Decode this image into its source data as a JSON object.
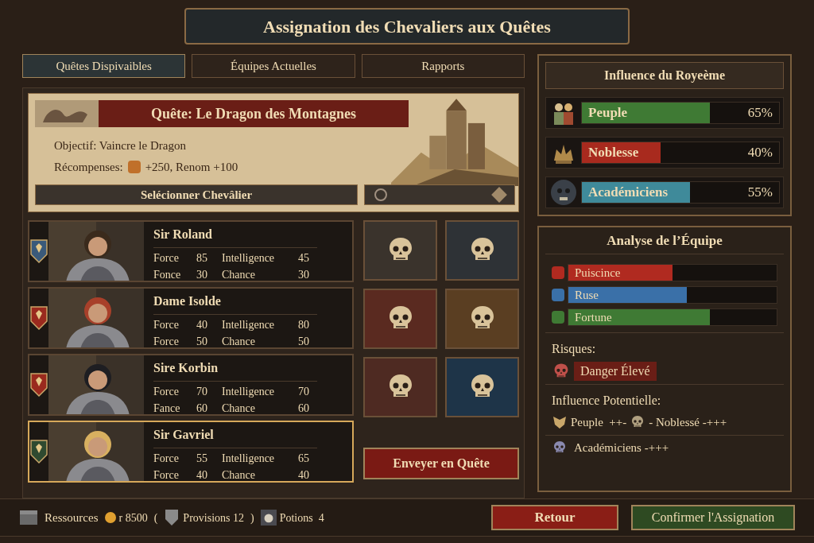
{
  "title": "Assignation des Chevaliers aux Quêtes",
  "tabs": [
    {
      "label": "Quêtes Dispivaibles",
      "selected": true
    },
    {
      "label": "Équipes Actuelles",
      "selected": false
    },
    {
      "label": "Rapports",
      "selected": false
    }
  ],
  "quest": {
    "title": "Quête: Le Dragon des Montagnes",
    "objective": "Objectif: Vaincre le Dragon",
    "rewards_label": "Récompenses:",
    "rewards_value": "+250, Renom +100",
    "select_button": "Selécionner Chevâlier"
  },
  "knights": [
    {
      "name": "Sir Roland",
      "selected": false,
      "color": "#3a5a7a",
      "stats": [
        {
          "label": "Force",
          "value": "85"
        },
        {
          "label": "Intelligence",
          "value": "45"
        },
        {
          "label": "Fonce",
          "value": "30"
        },
        {
          "label": "Chance",
          "value": "30"
        }
      ]
    },
    {
      "name": "Dame Isolde",
      "selected": false,
      "color": "#9a2a1e",
      "stats": [
        {
          "label": "Force",
          "value": "40"
        },
        {
          "label": "Intelligence",
          "value": "80"
        },
        {
          "label": "Force",
          "value": "50"
        },
        {
          "label": "Chance",
          "value": "50"
        }
      ]
    },
    {
      "name": "Sire Korbin",
      "selected": false,
      "color": "#9a2a1e",
      "stats": [
        {
          "label": "Force",
          "value": "70"
        },
        {
          "label": "Intelligence",
          "value": "70"
        },
        {
          "label": "Fance",
          "value": "60"
        },
        {
          "label": "Chance",
          "value": "60"
        }
      ]
    },
    {
      "name": "Sir Gavriel",
      "selected": true,
      "color": "#2f4a30",
      "stats": [
        {
          "label": "Force",
          "value": "55"
        },
        {
          "label": "Intelligence",
          "value": "65"
        },
        {
          "label": "Force",
          "value": "40"
        },
        {
          "label": "Chance",
          "value": "40"
        }
      ]
    }
  ],
  "equipment": [
    {
      "color": "#3a332c"
    },
    {
      "color": "#2e3236"
    },
    {
      "color": "#5a2a20"
    },
    {
      "color": "#5a3e22"
    },
    {
      "color": "#4e2a22"
    },
    {
      "color": "#1e3448"
    }
  ],
  "send_button": "Enveyer en Quête",
  "influence": {
    "title": "Influence du Royeème",
    "factions": [
      {
        "name": "Peuple",
        "level": 0.65,
        "reading": "65%",
        "color": "#3f7a34"
      },
      {
        "name": "Noblesse",
        "level": 0.4,
        "reading": "40%",
        "color": "#a82a1e"
      },
      {
        "name": "Académiciens",
        "level": 0.55,
        "reading": "55%",
        "color": "#3f8a9a"
      }
    ]
  },
  "analysis": {
    "title": "Analyse de l’Équipe",
    "attributes": [
      {
        "name": "Puiscince",
        "level": 0.5,
        "color": "#b02a20"
      },
      {
        "name": "Ruse",
        "level": 0.57,
        "color": "#3a70a8"
      },
      {
        "name": "Fortune",
        "level": 0.68,
        "color": "#3f7a34"
      }
    ],
    "risks_label": "Risques:",
    "risk": "Danger Élevé",
    "potential_label": "Influence Potentielle:",
    "potential_line_1a": "Peuple  ++-",
    "potential_line_1b": "- Noblessé -+++",
    "potential_line_2": "Académiciens -+++"
  },
  "resources": {
    "label": "Ressources",
    "items": [
      {
        "kind": "coin",
        "text": "r 8500"
      },
      {
        "kind": "plain",
        "text": "("
      },
      {
        "kind": "shield",
        "text": "Provisions 12"
      },
      {
        "kind": "plain",
        "text": ")"
      },
      {
        "kind": "potion",
        "text": "Potions  4"
      }
    ]
  },
  "buttons": {
    "back": "Retour",
    "confirm": "Confirmer l'Assignation"
  }
}
